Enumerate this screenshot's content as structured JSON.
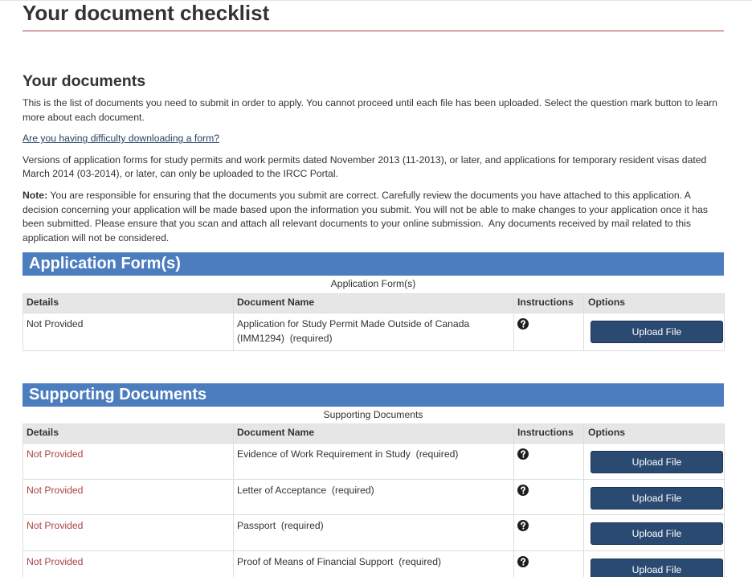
{
  "page": {
    "title": "Your document checklist"
  },
  "documents": {
    "heading": "Your documents",
    "intro": "This is the list of documents you need to submit in order to apply. You cannot proceed until each file has been uploaded. Select the question mark button to learn more about each document.",
    "help_link": "Are you having difficulty downloading a form?",
    "versions_note": "Versions of application forms for study permits and work permits dated November 2013 (11-2013), or later, and applications for temporary resident visas dated March 2014 (03-2014), or later, can only be uploaded to the IRCC Portal.",
    "note_label": "Note:",
    "note_text": "You are responsible for ensuring that the documents you submit are correct. Carefully review the documents you have attached to this application. A decision concerning your application will be made based upon the information you submit. You will not be able to make changes to your application once it has been submitted. Please ensure that you scan and attach all relevant documents to your online submission.  Any documents received by mail related to this application will not be considered."
  },
  "sections": [
    {
      "heading": "Application Form(s)",
      "caption": "Application Form(s)",
      "columns": [
        "Details",
        "Document Name",
        "Instructions",
        "Options"
      ],
      "rows": [
        {
          "details": "Not Provided",
          "status_color": "#333333",
          "document_name": "Application for Study Permit Made Outside of Canada (IMM1294)  (required)",
          "instructions_icon": "question-circle-icon",
          "action_label": "Upload File"
        }
      ]
    },
    {
      "heading": "Supporting Documents",
      "caption": "Supporting Documents",
      "columns": [
        "Details",
        "Document Name",
        "Instructions",
        "Options"
      ],
      "rows": [
        {
          "details": "Not Provided",
          "status_color": "#a94442",
          "document_name": "Evidence of Work Requirement in Study  (required)",
          "instructions_icon": "question-circle-icon",
          "action_label": "Upload File"
        },
        {
          "details": "Not Provided",
          "status_color": "#a94442",
          "document_name": "Letter of Acceptance  (required)",
          "instructions_icon": "question-circle-icon",
          "action_label": "Upload File"
        },
        {
          "details": "Not Provided",
          "status_color": "#a94442",
          "document_name": "Passport  (required)",
          "instructions_icon": "question-circle-icon",
          "action_label": "Upload File"
        },
        {
          "details": "Not Provided",
          "status_color": "#a94442",
          "document_name": "Proof of Means of Financial Support  (required)",
          "instructions_icon": "question-circle-icon",
          "action_label": "Upload File"
        }
      ]
    }
  ],
  "colors": {
    "accent": "#af3c43",
    "section_band": "#4c7ebf",
    "table_header": "#e6e6e6",
    "button": "#2b4a72",
    "link": "#284162",
    "text": "#333333",
    "status_not_provided": "#a94442"
  }
}
